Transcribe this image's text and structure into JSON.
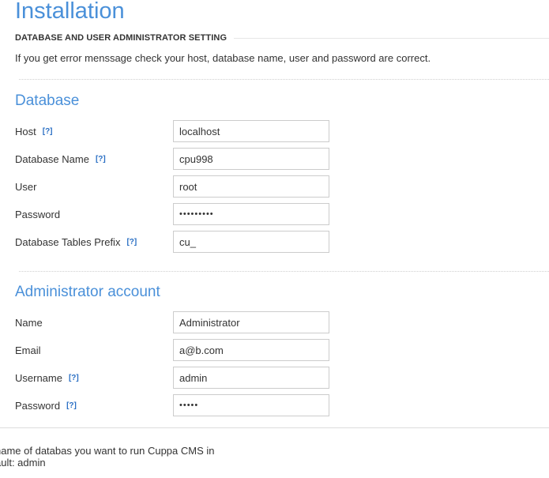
{
  "page": {
    "title": "Installation",
    "section_title": "DATABASE AND USER ADMINISTRATOR SETTING",
    "info_text": "If you get error menssage check your host, database name, user and password are correct."
  },
  "database": {
    "heading": "Database",
    "host": {
      "label": "Host",
      "help": "[?]",
      "value": "localhost"
    },
    "database_name": {
      "label": "Database Name",
      "help": "[?]",
      "value": "cpu998"
    },
    "user": {
      "label": "User",
      "value": "root"
    },
    "password": {
      "label": "Password",
      "value": "123456789"
    },
    "tables_prefix": {
      "label": "Database Tables Prefix",
      "help": "[?]",
      "value": "cu_"
    }
  },
  "admin": {
    "heading": "Administrator account",
    "name": {
      "label": "Name",
      "value": "Administrator"
    },
    "email": {
      "label": "Email",
      "value": "a@b.com"
    },
    "username": {
      "label": "Username",
      "help": "[?]",
      "value": "admin"
    },
    "password": {
      "label": "Password",
      "help": "[?]",
      "value": "admin"
    }
  },
  "footnotes": [
    "name of databas you want to run Cuppa CMS in",
    "ault: admin"
  ],
  "colors": {
    "accent_blue": "#4a90d9",
    "help_link": "#2a6fc4",
    "text": "#333333",
    "field_border": "#cccccc"
  }
}
